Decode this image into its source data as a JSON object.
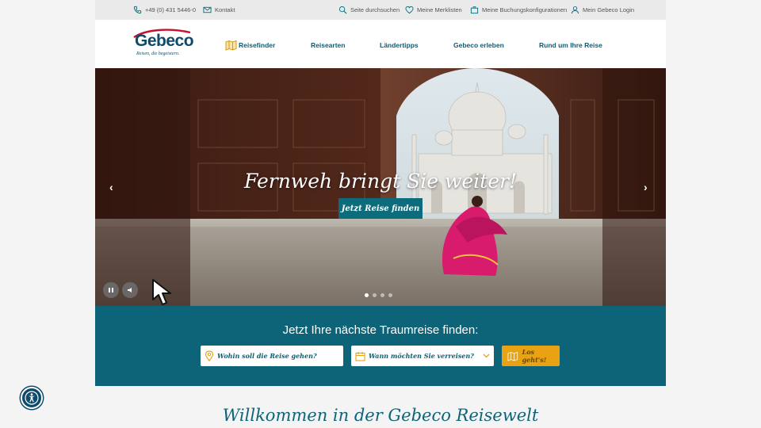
{
  "topbar": {
    "phone": "+49 (0) 431 5446-0",
    "contact": "Kontakt",
    "search": "Seite durchsuchen",
    "wishlist": "Meine Merklisten",
    "bookings": "Meine Buchungskonfigurationen",
    "login": "Mein Gebeco Login"
  },
  "brand": {
    "name": "Gebeco",
    "tagline": "Reisen, die begeistern."
  },
  "nav": {
    "items": [
      {
        "label": "Reisefinder"
      },
      {
        "label": "Reisearten"
      },
      {
        "label": "Ländertipps"
      },
      {
        "label": "Gebeco erleben"
      },
      {
        "label": "Rund um Ihre Reise"
      }
    ]
  },
  "hero": {
    "headline": "Fernweh bringt Sie weiter!",
    "cta": "Jetzt Reise finden",
    "slide_count": 4,
    "active_slide": 1
  },
  "search": {
    "title": "Jetzt Ihre nächste Traumreise finden:",
    "destination_placeholder": "Wohin soll die Reise gehen?",
    "date_placeholder": "Wann möchten Sie verreisen?",
    "submit": "Los geht's!"
  },
  "welcome": {
    "title": "Willkommen in der Gebeco Reisewelt"
  },
  "colors": {
    "teal": "#0d6478",
    "brand_blue": "#0e4a6b",
    "gold": "#e9a312",
    "brand_red": "#c8102e"
  }
}
